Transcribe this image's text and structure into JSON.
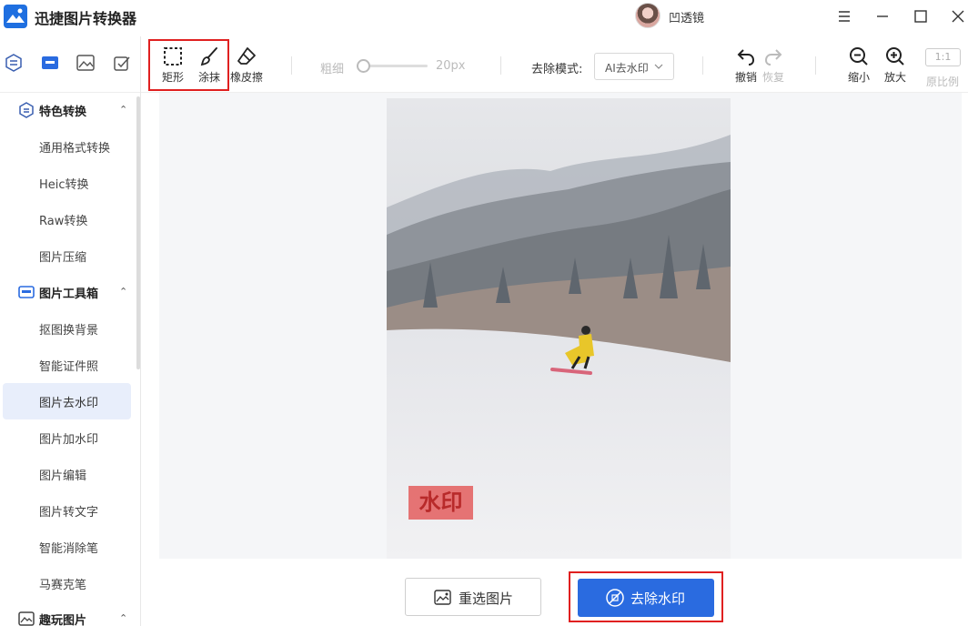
{
  "app": {
    "title": "迅捷图片转换器",
    "username": "凹透镜"
  },
  "toolbar": {
    "rect_label": "矩形",
    "smear_label": "涂抹",
    "eraser_label": "橡皮擦",
    "thickness_label": "粗细",
    "thickness_value": "20px",
    "thickness_level": 0.08,
    "mode_label": "去除模式:",
    "mode_value": "AI去水印",
    "undo_label": "撤销",
    "redo_label": "恢复",
    "zoom_out_label": "缩小",
    "zoom_in_label": "放大",
    "ratio_button": "1:1",
    "ratio_label": "原比例"
  },
  "sidebar": {
    "groups": [
      {
        "label": "特色转换",
        "icon": "convert-icon"
      },
      {
        "label": "图片工具箱",
        "icon": "toolbox-icon"
      },
      {
        "label": "趣玩图片",
        "icon": "fun-image-icon"
      }
    ],
    "items": [
      {
        "label": "通用格式转换"
      },
      {
        "label": "Heic转换"
      },
      {
        "label": "Raw转换"
      },
      {
        "label": "图片压缩"
      },
      {
        "label": "抠图换背景"
      },
      {
        "label": "智能证件照"
      },
      {
        "label": "图片去水印",
        "active": true
      },
      {
        "label": "图片加水印"
      },
      {
        "label": "图片编辑"
      },
      {
        "label": "图片转文字"
      },
      {
        "label": "智能消除笔"
      },
      {
        "label": "马赛克笔"
      }
    ]
  },
  "canvas": {
    "watermark_text": "水印"
  },
  "actions": {
    "reselect_label": "重选图片",
    "remove_label": "去除水印"
  },
  "colors": {
    "accent": "#2a6be0",
    "highlight": "#e02020",
    "active_bg": "#e8eefb"
  }
}
